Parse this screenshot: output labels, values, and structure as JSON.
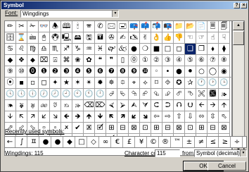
{
  "window": {
    "title": "Symbol"
  },
  "font": {
    "label": "Font:",
    "value": "Wingdings"
  },
  "recent": {
    "label": "Recently used symbols:",
    "symbols": [
      "←",
      "∫",
      "ㅍ",
      "●",
      "●",
      "◆",
      "□",
      "◇",
      "∞",
      "€",
      "£",
      "¥",
      "©",
      "®",
      "™",
      "±",
      "≠",
      "≤",
      "≥",
      "÷"
    ]
  },
  "status": {
    "char_name": "Wingdings: 115",
    "code_label": "Character code:",
    "code_value": "115",
    "from_label": "from:",
    "from_value": "Symbol (decimal)"
  },
  "buttons": {
    "ok": "OK",
    "cancel": "Cancel"
  },
  "grid_rows": [
    "✏✂✁👓🕭🕮🕯🕿✆🖂🖃📪📫📬📭📁📂📄🗏🗐",
    "🗄⌛🖮🖰🖲🖳🖴🖫🖬✇✍🖎✌👌👍👎☜☞☝☟",
    "♋♌♍♎♏♐♑♒♓🙰🙵●❍■□◻❑❒⬧⧫",
    "◆❖⬥⌧⍓⌘❀✿❝❞▯⓪①②③④⑤⑥⑦⑧",
    "⑨⑩⓿❶❷❸❹❺❻❼❽❾❿◦•●⚫○◯◉◎",
    "⦿▪▫◻✦★✶✴✹✵⯐⌖⟡⌑⯑✪✰🕐🕑🕒",
    "🕓🕔🕕🕖🕗🕘🕙🕚🕛⮰⮱⮲⮳⮴⮵⮶⮷🙪🙫🙕",
    "🙔🙗🙖🙐🙑🙒🙓⌫⌦⮘⮚⮙⮛⮈⮊⮉⮋🡨🡪🡩",
    "🡫🡬🡭🡯🡮🡸🡺🡹🡻🡼🡽🡿🡾⇦⇨⇧⇩⬄⇳⬁",
    "⬀⬃⬂🢬🢭🗶✔🗷🗹⊞⊟⊠⊡⊞⊟⊠⊡⊞⊟⊠",
    "⬁⬀⬃⬂🢬🢭🗶✔🗷🗹⊞⊟⊠⊡⊞⊟⊠⊡⊞⊟"
  ],
  "selected_cell": {
    "row": 2,
    "col": 16
  }
}
